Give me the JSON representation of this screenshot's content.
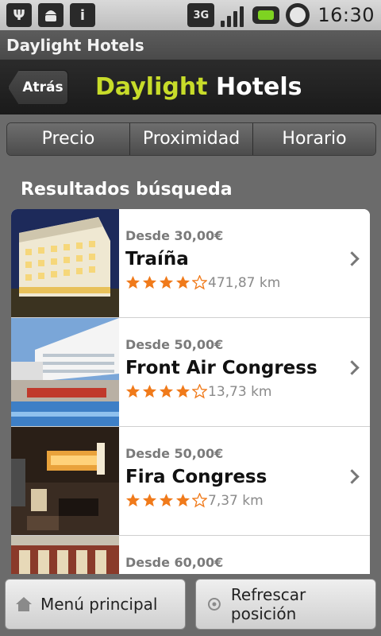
{
  "status_bar": {
    "time": "16:30",
    "network_label": "3G",
    "icons": [
      "usb-icon",
      "android-icon",
      "info-icon",
      "network-3g-icon",
      "signal-icon",
      "battery-icon",
      "alarm-clock-icon"
    ]
  },
  "window": {
    "title": "Daylight Hotels"
  },
  "header": {
    "back_label": "Atrás",
    "brand_part1": "Daylight",
    "brand_part2": "Hotels",
    "colors": {
      "brand_accent": "#c8dc2a"
    }
  },
  "tabs": [
    {
      "label": "Precio"
    },
    {
      "label": "Proximidad"
    },
    {
      "label": "Horario"
    }
  ],
  "results": {
    "title": "Resultados búsqueda",
    "items": [
      {
        "price": "Desde 30,00€",
        "name": "Traíña",
        "rating": 4,
        "max_rating": 5,
        "distance": "471,87 km",
        "image": "hotel-facade-photo"
      },
      {
        "price": "Desde 50,00€",
        "name": "Front Air Congress",
        "rating": 4,
        "max_rating": 5,
        "distance": "13,73 km",
        "image": "hotel-pool-photo"
      },
      {
        "price": "Desde 50,00€",
        "name": "Fira Congress",
        "rating": 4,
        "max_rating": 5,
        "distance": "7,37 km",
        "image": "hotel-lobby-photo"
      },
      {
        "price": "Desde 60,00€",
        "name": "",
        "rating": 0,
        "max_rating": 5,
        "distance": "",
        "image": "hotel-courtyard-photo"
      }
    ]
  },
  "bottom_bar": {
    "home_label": "Menú principal",
    "refresh_label": "Refrescar posición"
  }
}
